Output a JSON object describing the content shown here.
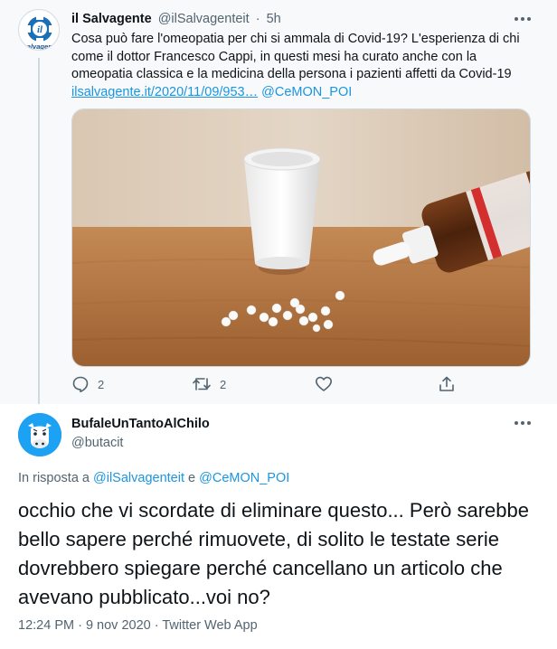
{
  "parent_tweet": {
    "author_name": "il Salvagente",
    "author_handle": "@ilSalvagenteit",
    "separator": "·",
    "time": "5h",
    "text": "Cosa può fare l'omeopatia per chi si ammala di Covid-19? L'esperienza di chi come il dottor Francesco Cappi, in questi mesi ha curato anche con la omeopatia classica e la medicina della persona i pazienti affetti da Covid-19",
    "link": "ilsalvagente.it/2020/11/09/953…",
    "mention": "@CeMON_POI",
    "avatar_logo": "il",
    "avatar_text": "salvagente",
    "media_icon": "homeopathy-bottle-and-pills-photo",
    "actions": {
      "reply_count": "2",
      "retweet_count": "2",
      "like_count": "",
      "share_count": ""
    }
  },
  "reply_tweet": {
    "author_name": "BufaleUnTantoAlChilo",
    "author_handle": "@butacit",
    "in_reply_prefix": "In risposta a ",
    "in_reply_user1": "@ilSalvagenteit",
    "in_reply_conj": " e ",
    "in_reply_user2": "@CeMON_POI",
    "text": "occhio che vi scordate di eliminare questo... Però sarebbe bello sapere perché rimuovete, di solito le testate serie dovrebbero spiegare perché cancellano un articolo che avevano pubblicato...voi no?",
    "meta": "12:24 PM · 9 nov 2020 · Twitter Web App"
  },
  "colors": {
    "text": "#0f1419",
    "secondary": "#536471",
    "link": "#1b95e0",
    "parent_background": "#f7f9fa"
  }
}
